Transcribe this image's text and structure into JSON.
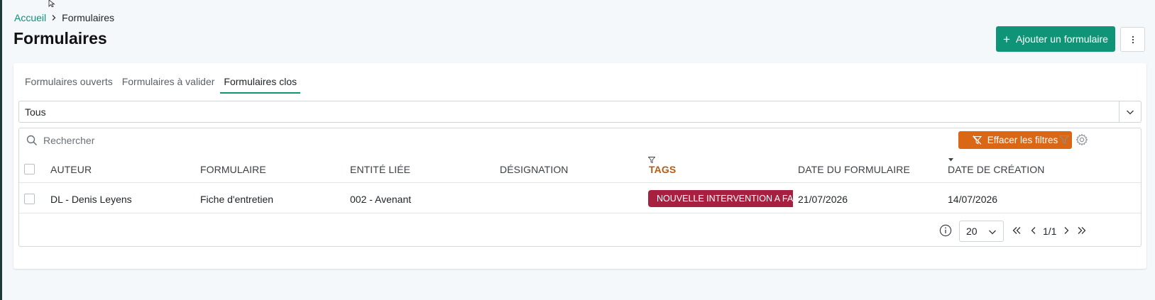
{
  "breadcrumb": {
    "home": "Accueil",
    "current": "Formulaires"
  },
  "page": {
    "title": "Formulaires"
  },
  "actions": {
    "add_label": "Ajouter un formulaire",
    "add_icon": "plus-icon",
    "more_icon": "vertical-dots-icon"
  },
  "tabs": [
    {
      "label": "Formulaires ouverts",
      "active": false
    },
    {
      "label": "Formulaires à valider",
      "active": false
    },
    {
      "label": "Formulaires clos",
      "active": true
    }
  ],
  "status_filter": {
    "value": "Tous"
  },
  "search": {
    "placeholder": "Rechercher"
  },
  "filters": {
    "clear_label": "Effacer les filtres"
  },
  "table": {
    "columns": {
      "author": "AUTEUR",
      "form": "FORMULAIRE",
      "entity": "ENTITÉ LIÉE",
      "designation": "DÉSIGNATION",
      "tags": "TAGS",
      "form_date": "DATE DU FORMULAIRE",
      "created": "DATE DE CRÉATION"
    },
    "rows": [
      {
        "author": "DL - Denis Leyens",
        "form": "Fiche d'entretien",
        "entity": "002 - Avenant",
        "designation": "",
        "tag": "NOUVELLE INTERVENTION A FAIRE",
        "form_date": "21/07/2026",
        "created": "14/07/2026"
      }
    ]
  },
  "pagination": {
    "page_size": "20",
    "page_info": "1/1"
  },
  "colors": {
    "primary": "#0f9477",
    "link": "#0e8f77",
    "clear_filters": "#d96716",
    "active_filter_header": "#b85b12",
    "tag": "#a82040"
  }
}
